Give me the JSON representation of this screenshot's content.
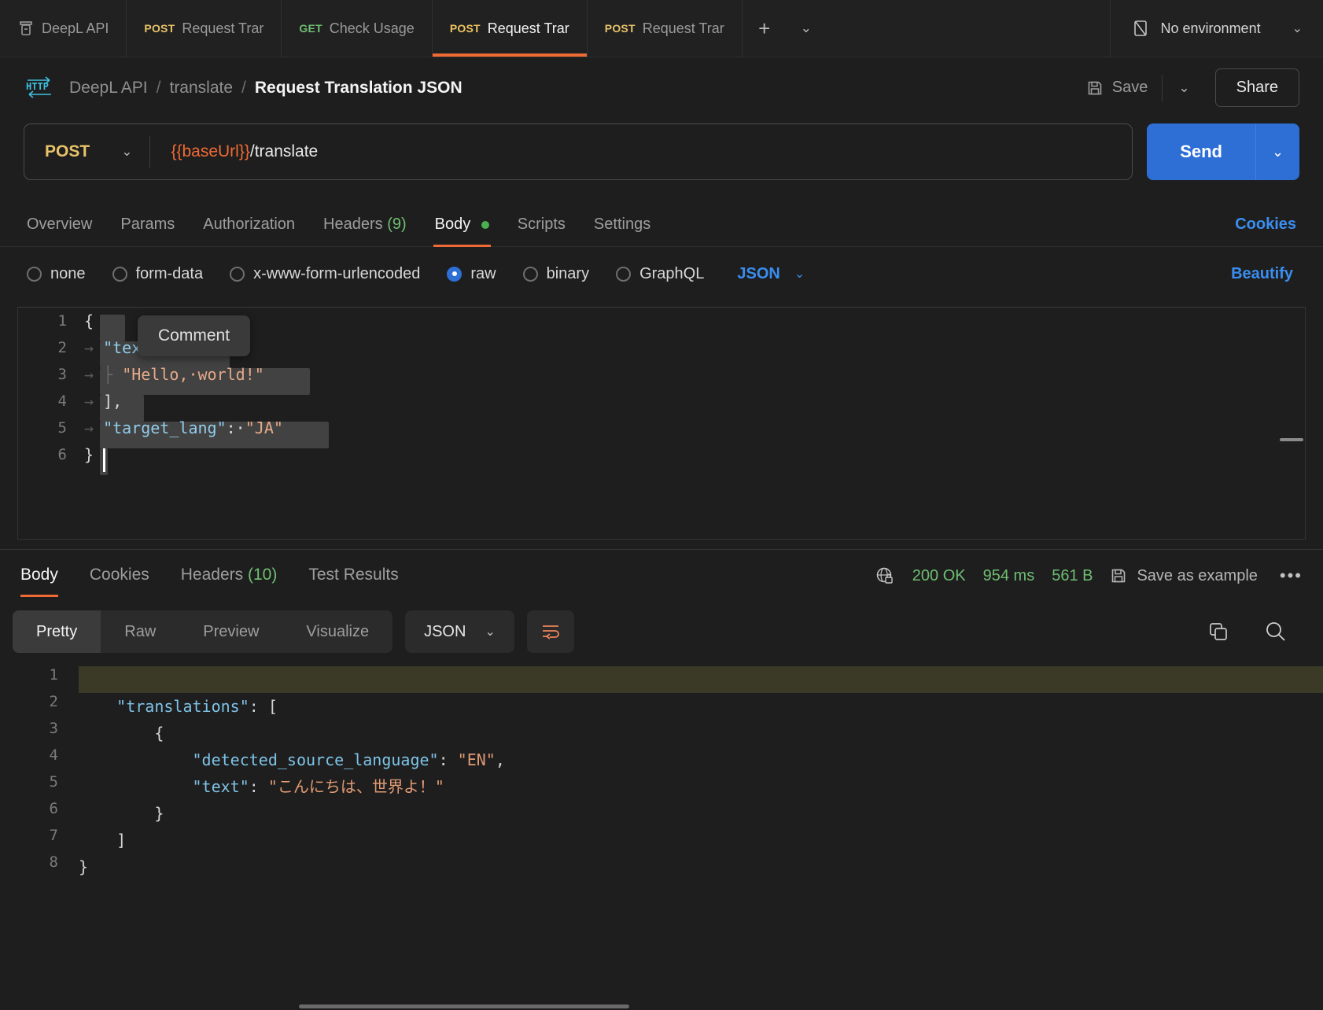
{
  "tabstrip": {
    "tabs": [
      {
        "method": "",
        "label": "DeepL API",
        "icon": "collection-icon",
        "active": false
      },
      {
        "method": "POST",
        "label": "Request Trar",
        "active": false
      },
      {
        "method": "GET",
        "label": "Check Usage",
        "active": false
      },
      {
        "method": "POST",
        "label": "Request Trar",
        "active": true
      },
      {
        "method": "POST",
        "label": "Request Trar",
        "active": false
      }
    ],
    "new_tab_label": "+",
    "tab_list_caret": "⌄",
    "environment": "No environment",
    "environment_caret": "⌄"
  },
  "breadcrumb": {
    "protocol_badge": "HTTP",
    "collection": "DeepL API",
    "sep1": "/",
    "folder": "translate",
    "sep2": "/",
    "request": "Request Translation JSON",
    "save_label": "Save",
    "save_caret": "⌄",
    "share_label": "Share"
  },
  "url_bar": {
    "method": "POST",
    "method_caret": "⌄",
    "url_variable": "{{baseUrl}}",
    "url_path": "/translate",
    "send_label": "Send",
    "send_caret": "⌄"
  },
  "request_tabs": {
    "items": [
      {
        "label": "Overview",
        "count": "",
        "active": false,
        "dot": false
      },
      {
        "label": "Params",
        "count": "",
        "active": false,
        "dot": false
      },
      {
        "label": "Authorization",
        "count": "",
        "active": false,
        "dot": false
      },
      {
        "label": "Headers",
        "count": "(9)",
        "active": false,
        "dot": false
      },
      {
        "label": "Body",
        "count": "",
        "active": true,
        "dot": true
      },
      {
        "label": "Scripts",
        "count": "",
        "active": false,
        "dot": false
      },
      {
        "label": "Settings",
        "count": "",
        "active": false,
        "dot": false
      }
    ],
    "cookies_label": "Cookies"
  },
  "body_types": {
    "options": [
      {
        "label": "none",
        "selected": false
      },
      {
        "label": "form-data",
        "selected": false
      },
      {
        "label": "x-www-form-urlencoded",
        "selected": false
      },
      {
        "label": "raw",
        "selected": true
      },
      {
        "label": "binary",
        "selected": false
      },
      {
        "label": "GraphQL",
        "selected": false
      }
    ],
    "format": "JSON",
    "format_caret": "⌄",
    "beautify_label": "Beautify"
  },
  "request_editor": {
    "tooltip": "Comment",
    "line_numbers": [
      "1",
      "2",
      "3",
      "4",
      "5",
      "6"
    ],
    "lines": [
      {
        "n": "1",
        "text": "{"
      },
      {
        "n": "2",
        "text": "  \"text\": ["
      },
      {
        "n": "3",
        "text": "    \"Hello, world!\""
      },
      {
        "n": "4",
        "text": "  ],"
      },
      {
        "n": "5",
        "text": "  \"target_lang\": \"JA\""
      },
      {
        "n": "6",
        "text": "}"
      }
    ]
  },
  "response_header": {
    "tabs": [
      {
        "label": "Body",
        "count": "",
        "active": true
      },
      {
        "label": "Cookies",
        "count": "",
        "active": false
      },
      {
        "label": "Headers",
        "count": "(10)",
        "active": false
      },
      {
        "label": "Test Results",
        "count": "",
        "active": false
      }
    ],
    "status": "200 OK",
    "time": "954 ms",
    "size": "561 B",
    "save_as_example": "Save as example",
    "more_dots": "•••"
  },
  "response_toolbar": {
    "views": [
      {
        "label": "Pretty",
        "active": true
      },
      {
        "label": "Raw",
        "active": false
      },
      {
        "label": "Preview",
        "active": false
      },
      {
        "label": "Visualize",
        "active": false
      }
    ],
    "format": "JSON",
    "format_caret": "⌄",
    "wrap_icon": "wrap-lines-icon",
    "copy_icon": "copy-icon",
    "search_icon": "search-icon"
  },
  "response_body": {
    "line_numbers": [
      "1",
      "2",
      "3",
      "4",
      "5",
      "6",
      "7",
      "8"
    ],
    "lines": [
      {
        "n": "1",
        "text": "{"
      },
      {
        "n": "2",
        "text": "    \"translations\": ["
      },
      {
        "n": "3",
        "text": "        {"
      },
      {
        "n": "4",
        "text": "            \"detected_source_language\": \"EN\","
      },
      {
        "n": "5",
        "text": "            \"text\": \"こんにちは、世界よ！\""
      },
      {
        "n": "6",
        "text": "        }"
      },
      {
        "n": "7",
        "text": "    ]"
      },
      {
        "n": "8",
        "text": "}"
      }
    ],
    "json_values": {
      "translations": [
        {
          "detected_source_language": "EN",
          "text": "こんにちは、世界よ！"
        }
      ]
    }
  },
  "colors": {
    "accent_orange": "#f06a35",
    "accent_blue": "#2e6fd6",
    "link_blue": "#3a8ef0",
    "success_green": "#6fbf73",
    "method_post": "#e8c36a",
    "method_get": "#6fbf73",
    "json_key": "#7ec4e8",
    "json_string": "#e09a74",
    "bg": "#1e1e1e"
  }
}
